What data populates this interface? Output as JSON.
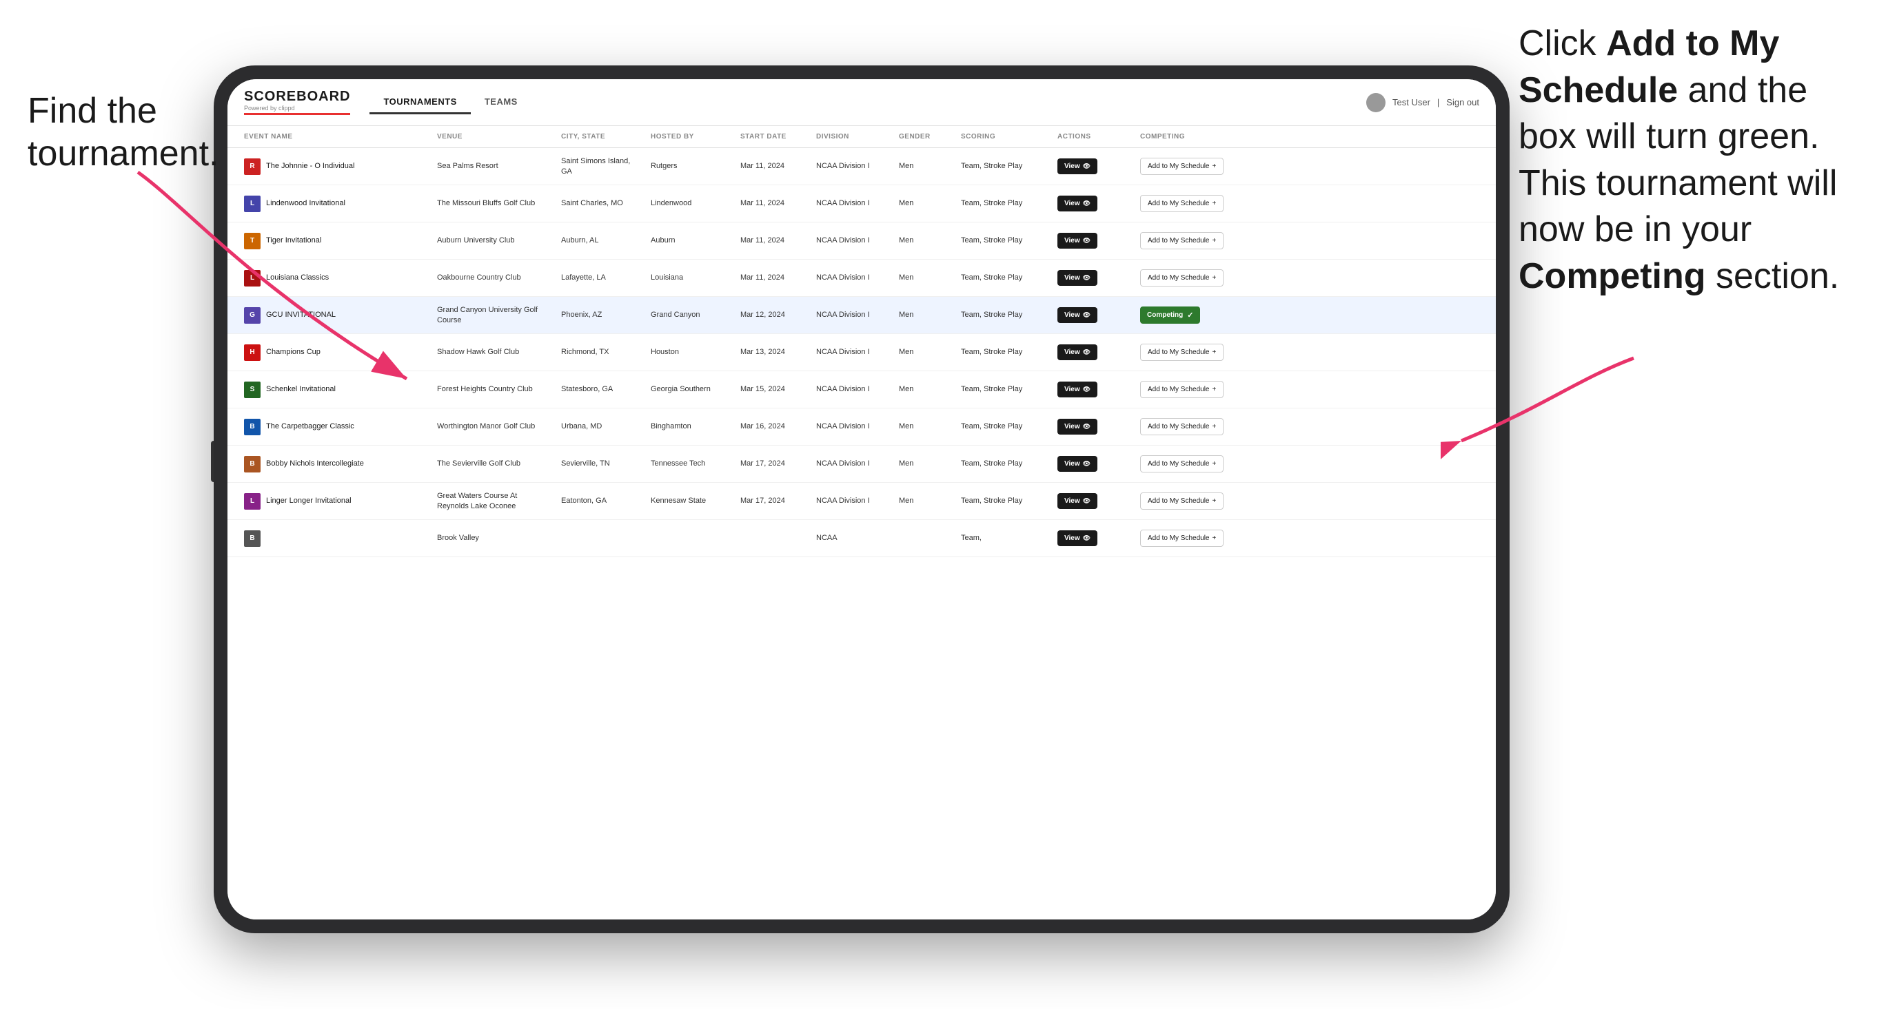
{
  "annotations": {
    "left_text_line1": "Find the",
    "left_text_line2": "tournament.",
    "right_text": "Click ",
    "right_bold1": "Add to My Schedule",
    "right_mid": " and the box will turn green. This tournament will now be in your ",
    "right_bold2": "Competing",
    "right_end": " section."
  },
  "header": {
    "logo": "SCOREBOARD",
    "logo_sub": "Powered by clippd",
    "nav_tabs": [
      "TOURNAMENTS",
      "TEAMS"
    ],
    "active_tab": "TOURNAMENTS",
    "user": "Test User",
    "sign_out": "Sign out"
  },
  "table": {
    "columns": [
      "EVENT NAME",
      "VENUE",
      "CITY, STATE",
      "HOSTED BY",
      "START DATE",
      "DIVISION",
      "GENDER",
      "SCORING",
      "ACTIONS",
      "COMPETING"
    ],
    "rows": [
      {
        "id": 1,
        "logo_color": "#cc2222",
        "logo_letter": "R",
        "event_name": "The Johnnie - O Individual",
        "venue": "Sea Palms Resort",
        "city_state": "Saint Simons Island, GA",
        "hosted_by": "Rutgers",
        "start_date": "Mar 11, 2024",
        "division": "NCAA Division I",
        "gender": "Men",
        "scoring": "Team, Stroke Play",
        "action": "view",
        "competing_status": "add",
        "highlighted": false
      },
      {
        "id": 2,
        "logo_color": "#4444aa",
        "logo_letter": "L",
        "event_name": "Lindenwood Invitational",
        "venue": "The Missouri Bluffs Golf Club",
        "city_state": "Saint Charles, MO",
        "hosted_by": "Lindenwood",
        "start_date": "Mar 11, 2024",
        "division": "NCAA Division I",
        "gender": "Men",
        "scoring": "Team, Stroke Play",
        "action": "view",
        "competing_status": "add",
        "highlighted": false
      },
      {
        "id": 3,
        "logo_color": "#cc6600",
        "logo_letter": "T",
        "event_name": "Tiger Invitational",
        "venue": "Auburn University Club",
        "city_state": "Auburn, AL",
        "hosted_by": "Auburn",
        "start_date": "Mar 11, 2024",
        "division": "NCAA Division I",
        "gender": "Men",
        "scoring": "Team, Stroke Play",
        "action": "view",
        "competing_status": "add",
        "highlighted": false
      },
      {
        "id": 4,
        "logo_color": "#aa1111",
        "logo_letter": "L",
        "event_name": "Louisiana Classics",
        "venue": "Oakbourne Country Club",
        "city_state": "Lafayette, LA",
        "hosted_by": "Louisiana",
        "start_date": "Mar 11, 2024",
        "division": "NCAA Division I",
        "gender": "Men",
        "scoring": "Team, Stroke Play",
        "action": "view",
        "competing_status": "add",
        "highlighted": false
      },
      {
        "id": 5,
        "logo_color": "#5544aa",
        "logo_letter": "G",
        "event_name": "GCU INVITATIONAL",
        "venue": "Grand Canyon University Golf Course",
        "city_state": "Phoenix, AZ",
        "hosted_by": "Grand Canyon",
        "start_date": "Mar 12, 2024",
        "division": "NCAA Division I",
        "gender": "Men",
        "scoring": "Team, Stroke Play",
        "action": "view",
        "competing_status": "competing",
        "highlighted": true
      },
      {
        "id": 6,
        "logo_color": "#cc1111",
        "logo_letter": "H",
        "event_name": "Champions Cup",
        "venue": "Shadow Hawk Golf Club",
        "city_state": "Richmond, TX",
        "hosted_by": "Houston",
        "start_date": "Mar 13, 2024",
        "division": "NCAA Division I",
        "gender": "Men",
        "scoring": "Team, Stroke Play",
        "action": "view",
        "competing_status": "add",
        "highlighted": false
      },
      {
        "id": 7,
        "logo_color": "#226622",
        "logo_letter": "S",
        "event_name": "Schenkel Invitational",
        "venue": "Forest Heights Country Club",
        "city_state": "Statesboro, GA",
        "hosted_by": "Georgia Southern",
        "start_date": "Mar 15, 2024",
        "division": "NCAA Division I",
        "gender": "Men",
        "scoring": "Team, Stroke Play",
        "action": "view",
        "competing_status": "add",
        "highlighted": false
      },
      {
        "id": 8,
        "logo_color": "#1155aa",
        "logo_letter": "B",
        "event_name": "The Carpetbagger Classic",
        "venue": "Worthington Manor Golf Club",
        "city_state": "Urbana, MD",
        "hosted_by": "Binghamton",
        "start_date": "Mar 16, 2024",
        "division": "NCAA Division I",
        "gender": "Men",
        "scoring": "Team, Stroke Play",
        "action": "view",
        "competing_status": "add",
        "highlighted": false
      },
      {
        "id": 9,
        "logo_color": "#aa5522",
        "logo_letter": "B",
        "event_name": "Bobby Nichols Intercollegiate",
        "venue": "The Sevierville Golf Club",
        "city_state": "Sevierville, TN",
        "hosted_by": "Tennessee Tech",
        "start_date": "Mar 17, 2024",
        "division": "NCAA Division I",
        "gender": "Men",
        "scoring": "Team, Stroke Play",
        "action": "view",
        "competing_status": "add",
        "highlighted": false
      },
      {
        "id": 10,
        "logo_color": "#882288",
        "logo_letter": "L",
        "event_name": "Linger Longer Invitational",
        "venue": "Great Waters Course At Reynolds Lake Oconee",
        "city_state": "Eatonton, GA",
        "hosted_by": "Kennesaw State",
        "start_date": "Mar 17, 2024",
        "division": "NCAA Division I",
        "gender": "Men",
        "scoring": "Team, Stroke Play",
        "action": "view",
        "competing_status": "add",
        "highlighted": false
      },
      {
        "id": 11,
        "logo_color": "#555555",
        "logo_letter": "B",
        "event_name": "",
        "venue": "Brook Valley",
        "city_state": "",
        "hosted_by": "",
        "start_date": "",
        "division": "NCAA",
        "gender": "",
        "scoring": "Team,",
        "action": "view",
        "competing_status": "add",
        "highlighted": false
      }
    ]
  },
  "buttons": {
    "view_label": "View",
    "add_schedule_label": "Add to My Schedule",
    "competing_label": "Competing"
  }
}
